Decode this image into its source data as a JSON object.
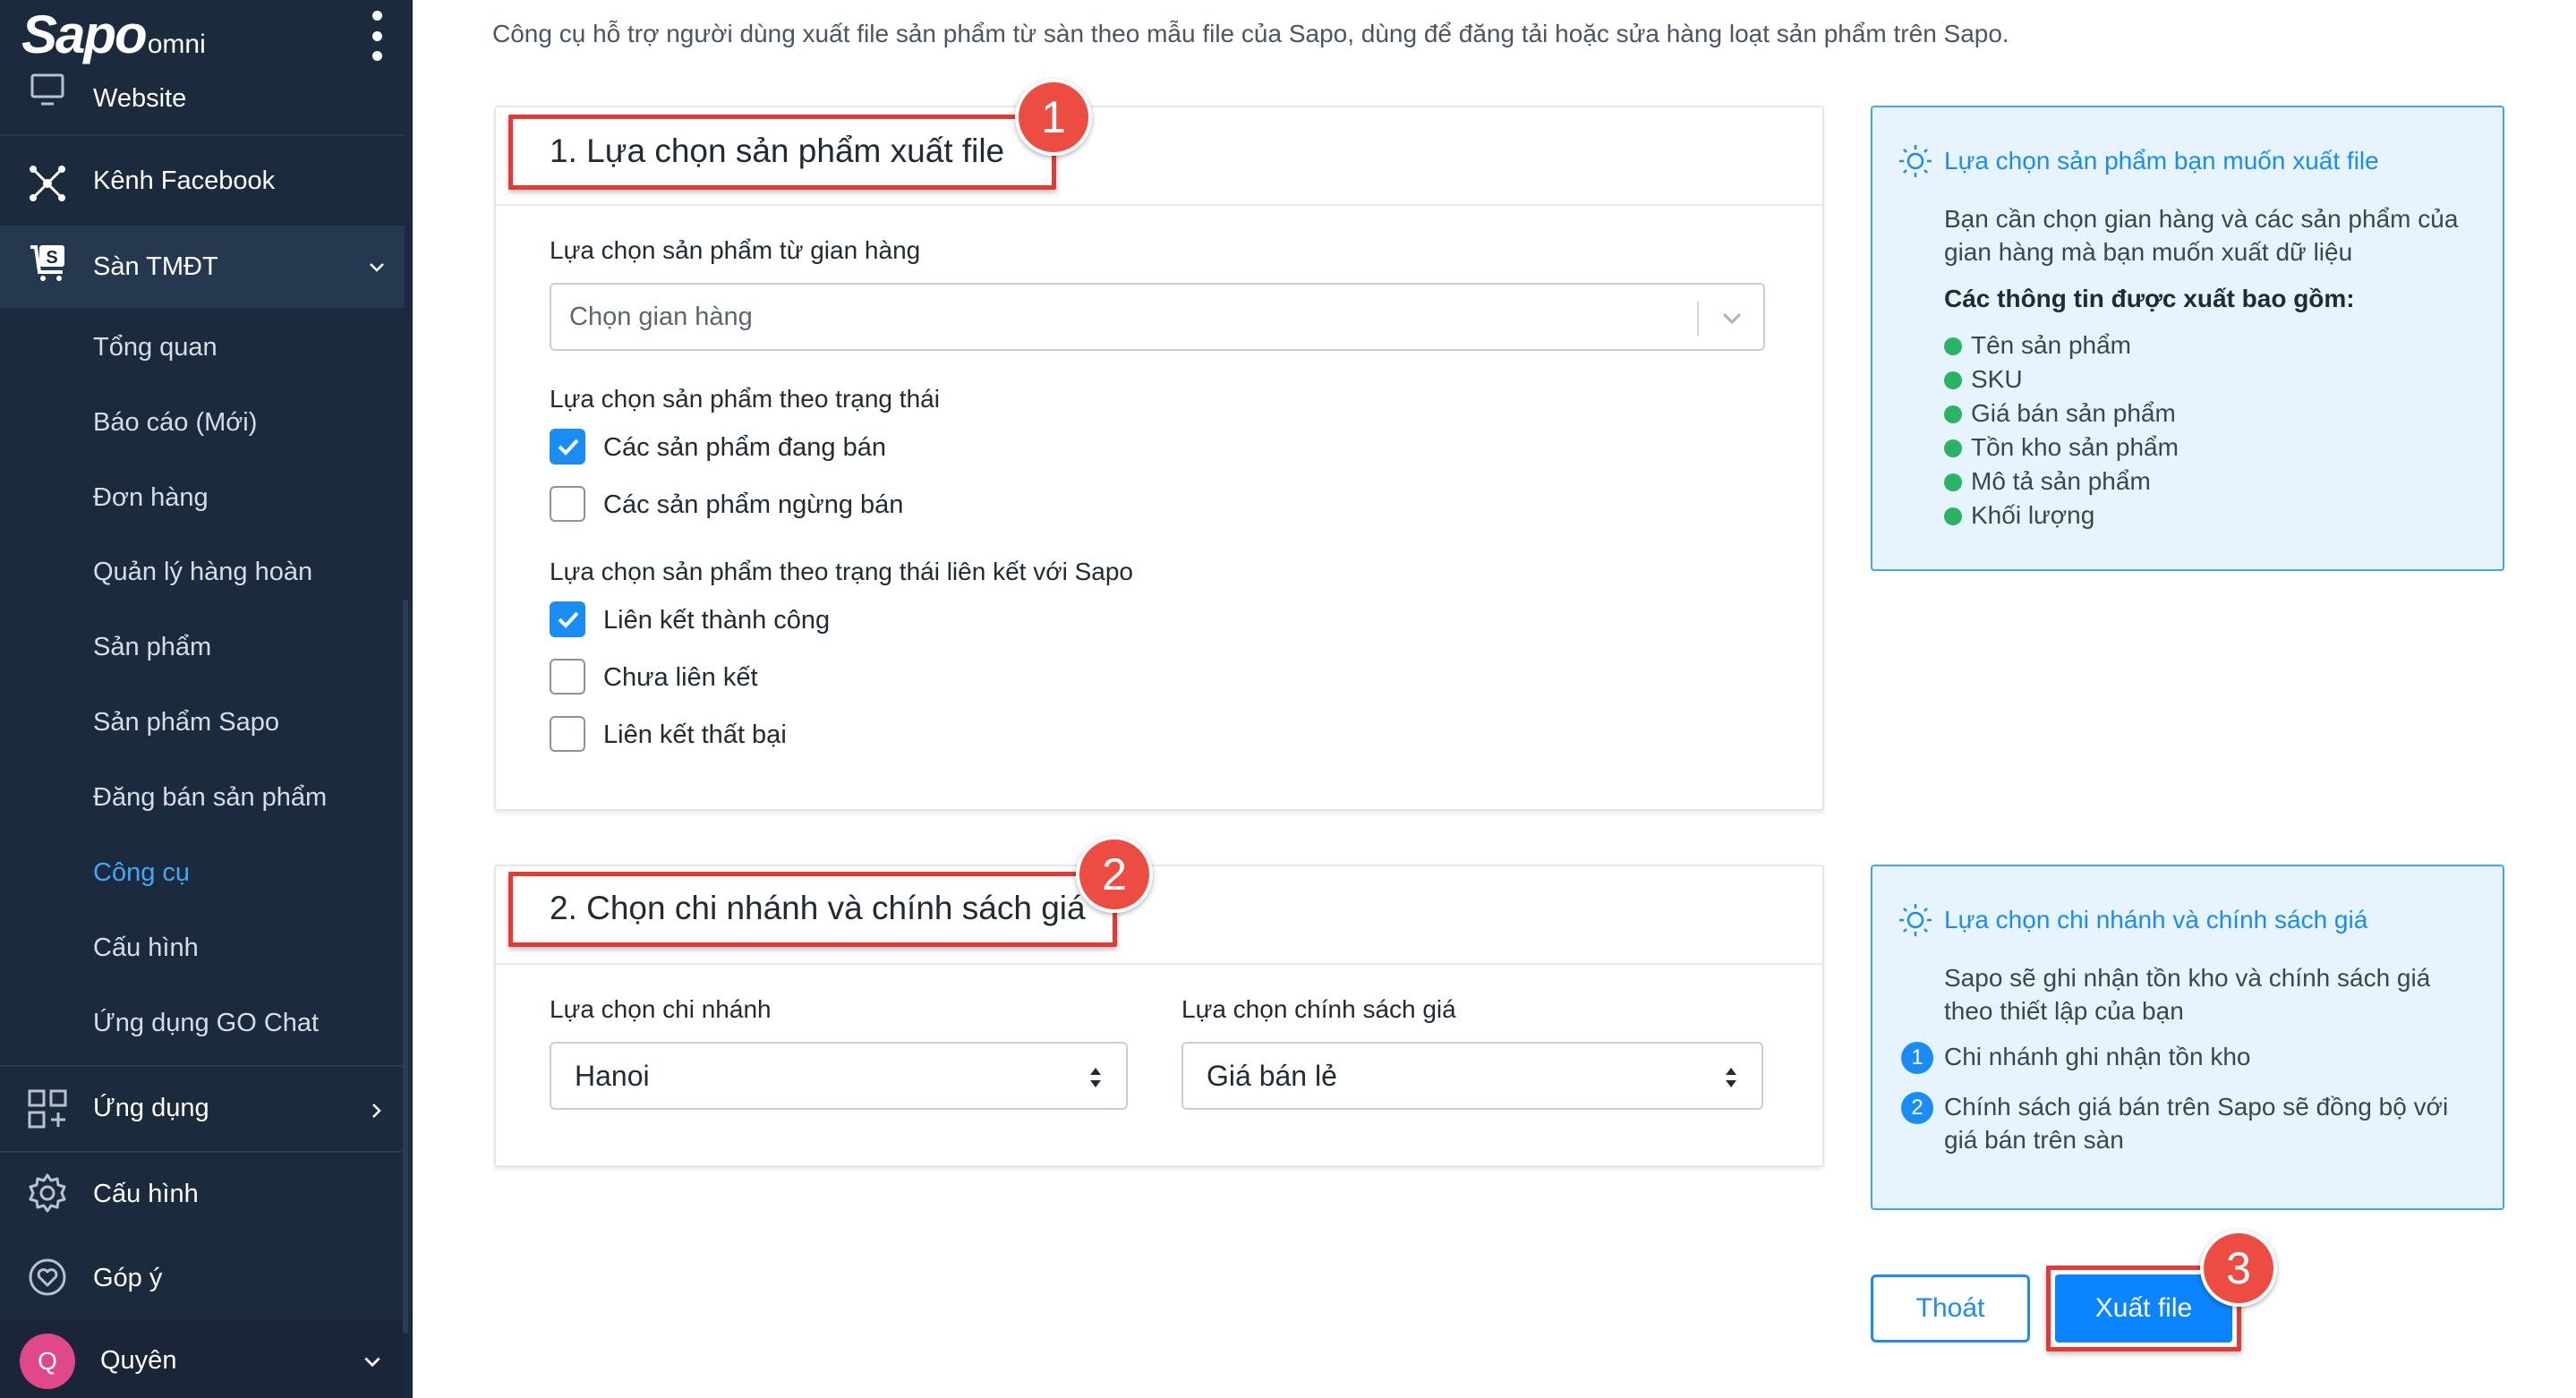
{
  "sidebar": {
    "logo_main": "Sapo",
    "logo_sub": "omni",
    "items": [
      {
        "label": "Website"
      },
      {
        "label": "Kênh Facebook"
      },
      {
        "label": "Sàn TMĐT"
      }
    ],
    "subitems": [
      {
        "label": "Tổng quan"
      },
      {
        "label": "Báo cáo (Mới)"
      },
      {
        "label": "Đơn hàng"
      },
      {
        "label": "Quản lý hàng hoàn"
      },
      {
        "label": "Sản phẩm"
      },
      {
        "label": "Sản phẩm Sapo"
      },
      {
        "label": "Đăng bán sản phẩm"
      },
      {
        "label": "Công cụ"
      },
      {
        "label": "Cấu hình"
      },
      {
        "label": "Ứng dụng GO Chat"
      }
    ],
    "bottom_items": [
      {
        "label": "Ứng dụng"
      },
      {
        "label": "Cấu hình"
      },
      {
        "label": "Góp ý"
      }
    ],
    "user": {
      "initial": "Q",
      "name": "Quyên"
    }
  },
  "main": {
    "intro": "Công cụ hỗ trợ người dùng xuất file sản phẩm từ sàn theo mẫu file của Sapo, dùng để đăng tải hoặc sửa hàng loạt sản phẩm trên Sapo.",
    "section1": {
      "badge": "1",
      "title": "1. Lựa chọn sản phẩm xuất file",
      "store_label": "Lựa chọn sản phẩm từ gian hàng",
      "store_placeholder": "Chọn gian hàng",
      "status_label": "Lựa chọn sản phẩm theo trạng thái",
      "status_options": [
        {
          "label": "Các sản phẩm đang bán",
          "checked": true
        },
        {
          "label": "Các sản phẩm ngừng bán",
          "checked": false
        }
      ],
      "link_label": "Lựa chọn sản phẩm theo trạng thái liên kết với Sapo",
      "link_options": [
        {
          "label": "Liên kết thành công",
          "checked": true
        },
        {
          "label": "Chưa liên kết",
          "checked": false
        },
        {
          "label": "Liên kết thất bại",
          "checked": false
        }
      ]
    },
    "section2": {
      "badge": "2",
      "title": "2. Chọn chi nhánh và chính sách giá",
      "branch_label": "Lựa chọn chi nhánh",
      "branch_value": "Hanoi",
      "price_label": "Lựa chọn chính sách giá",
      "price_value": "Giá bán lẻ"
    },
    "info1": {
      "title": "Lựa chọn sản phẩm bạn muốn xuất file",
      "text": "Bạn cần chọn gian hàng và các sản phẩm của gian hàng mà bạn muốn xuất dữ liệu",
      "bold": "Các thông tin được xuất bao gồm:",
      "list": [
        "Tên sản phẩm",
        "SKU",
        "Giá bán sản phẩm",
        "Tồn kho sản phẩm",
        "Mô tả sản phẩm",
        "Khối lượng"
      ]
    },
    "info2": {
      "title": "Lựa chọn chi nhánh và chính sách giá",
      "text": "Sapo sẽ ghi nhận tồn kho và chính sách giá theo thiết lập của bạn",
      "points": [
        {
          "num": "1",
          "text": "Chi nhánh ghi nhận tồn kho"
        },
        {
          "num": "2",
          "text": "Chính sách giá bán trên Sapo sẽ đồng bộ với giá bán trên sàn"
        }
      ]
    },
    "buttons": {
      "exit": "Thoát",
      "export": "Xuất file",
      "badge": "3"
    }
  },
  "colors": {
    "sidebar_bg": "#1c2a3d",
    "accent": "#1a8cf5",
    "highlight_red": "#e53935",
    "active_link": "#3fa9f5"
  }
}
